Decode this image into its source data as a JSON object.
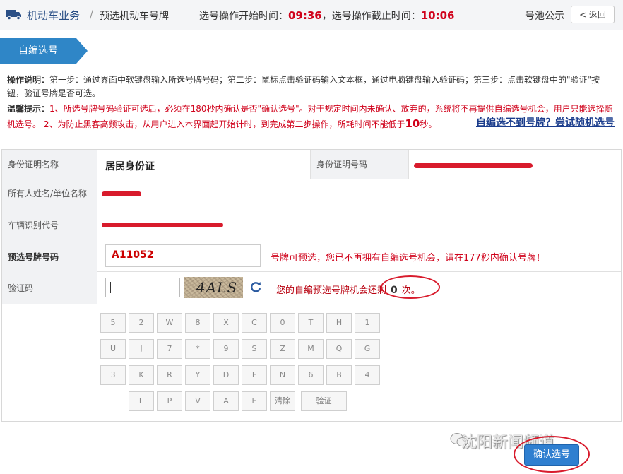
{
  "header": {
    "breadcrumb_main": "机动车业务",
    "breadcrumb_sep": "/",
    "breadcrumb_sub": "预选机动车号牌",
    "time_prefix": "选号操作开始时间：",
    "start_time": "09:36",
    "time_mid": "，选号操作截止时间：",
    "end_time": "10:06",
    "pool_label": "号池公示",
    "back_label": "< 返回"
  },
  "section_tab": "自编选号",
  "instructions": {
    "op_label": "操作说明：",
    "op_text": "第一步：通过界面中软键盘输入所选号牌号码；第二步：鼠标点击验证码输入文本框，通过电脑键盘输入验证码；第三步：点击软键盘中的\"验证\"按钮，验证号牌是否可选。",
    "tip_label": "温馨提示：",
    "tip_text_1": "1、所选号牌号码验证可选后，必须在180秒内确认是否\"确认选号\"。对于规定时间内未确认、放弃的，系统将不再提供自编选号机会，用户只能选择随机选号。 2、为防止黑客高频攻击，从用户进入本界面起开始计时，到完成第二步操作，所耗时间不能低于",
    "tip_big": "10",
    "tip_text_2": "秒。",
    "random_link": "自编选不到号牌？尝试随机选号"
  },
  "form": {
    "id_type_label": "身份证明名称",
    "id_type_value": "居民身份证",
    "id_no_label": "身份证明号码",
    "owner_label": "所有人姓名/单位名称",
    "vin_label": "车辆识别代号",
    "plate_label": "预选号牌号码",
    "plate_value": "A11052",
    "plate_msg": "号牌可预选，您已不再拥有自编选号机会，请在177秒内确认号牌！",
    "captcha_label": "验证码",
    "captcha_text": "4ALS",
    "remaining_prefix": "您的自编预选号牌机会还剩",
    "remaining_count": "0",
    "remaining_suffix": "次。"
  },
  "keyboard": {
    "row1": [
      "5",
      "2",
      "W",
      "8",
      "X",
      "C",
      "0",
      "T",
      "H",
      "1"
    ],
    "row2": [
      "U",
      "J",
      "7",
      "*",
      "9",
      "S",
      "Z",
      "M",
      "Q",
      "G"
    ],
    "row3": [
      "3",
      "K",
      "R",
      "Y",
      "D",
      "F",
      "N",
      "6",
      "B",
      "4"
    ],
    "row4": [
      "L",
      "P",
      "V",
      "A",
      "E"
    ],
    "clear_label": "清除",
    "verify_label": "验证"
  },
  "footer": {
    "watermark": "沈阳新闻频道",
    "confirm_label": "确认选号"
  },
  "colors": {
    "accent_blue": "#2f86c7",
    "alert_red": "#d0021b",
    "link_blue": "#1a3c8c"
  }
}
